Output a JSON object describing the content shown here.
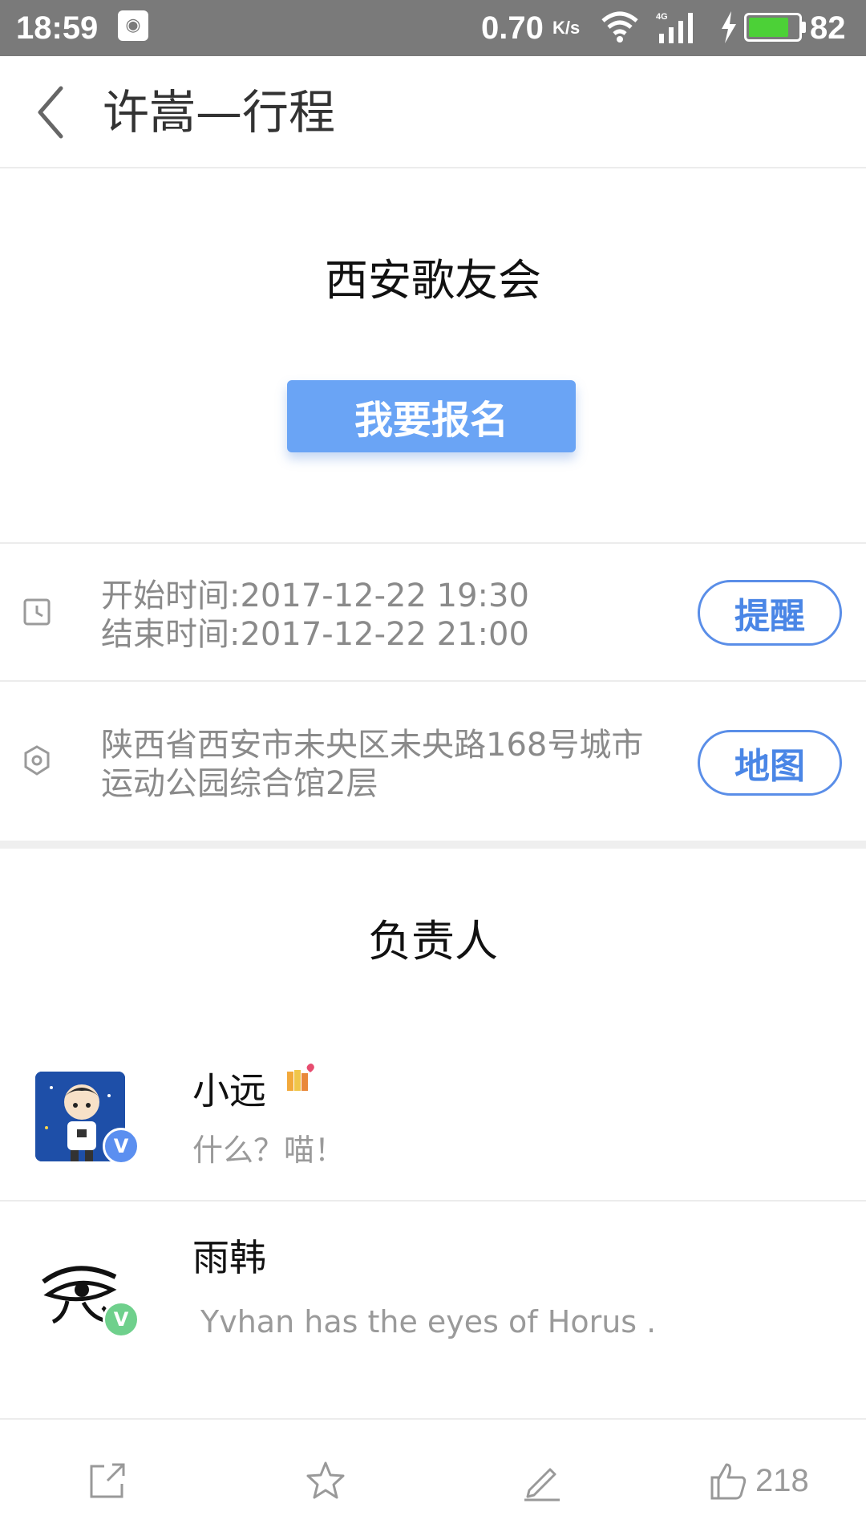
{
  "status_bar": {
    "time": "18:59",
    "net_speed": "0.70",
    "net_unit": "K/s",
    "battery_level": "82",
    "battery_fraction": 0.82,
    "network_type": "4G"
  },
  "header": {
    "title": "许嵩—行程"
  },
  "event": {
    "title": "西安歌友会",
    "signup_label": "我要报名"
  },
  "time_info": {
    "start": "开始时间:2017-12-22 19:30",
    "end": "结束时间:2017-12-22 21:00",
    "remind_label": "提醒"
  },
  "location_info": {
    "line1": "陕西省西安市未央区未央路168号城市",
    "line2": "运动公园综合馆2层",
    "map_label": "地图"
  },
  "responsible": {
    "heading": "负责人",
    "people": [
      {
        "name": "小远",
        "subtitle": "什么？喵！",
        "badge_color": "#5b8ff0"
      },
      {
        "name": "雨韩",
        "subtitle": "Yvhan has the eyes of Horus .",
        "badge_color": "#6fd08c"
      }
    ]
  },
  "toolbar": {
    "like_count": "218"
  },
  "colors": {
    "accent": "#6aa4f5",
    "pill_border": "#5a8ee8",
    "status_bar": "#7a7a7a"
  }
}
